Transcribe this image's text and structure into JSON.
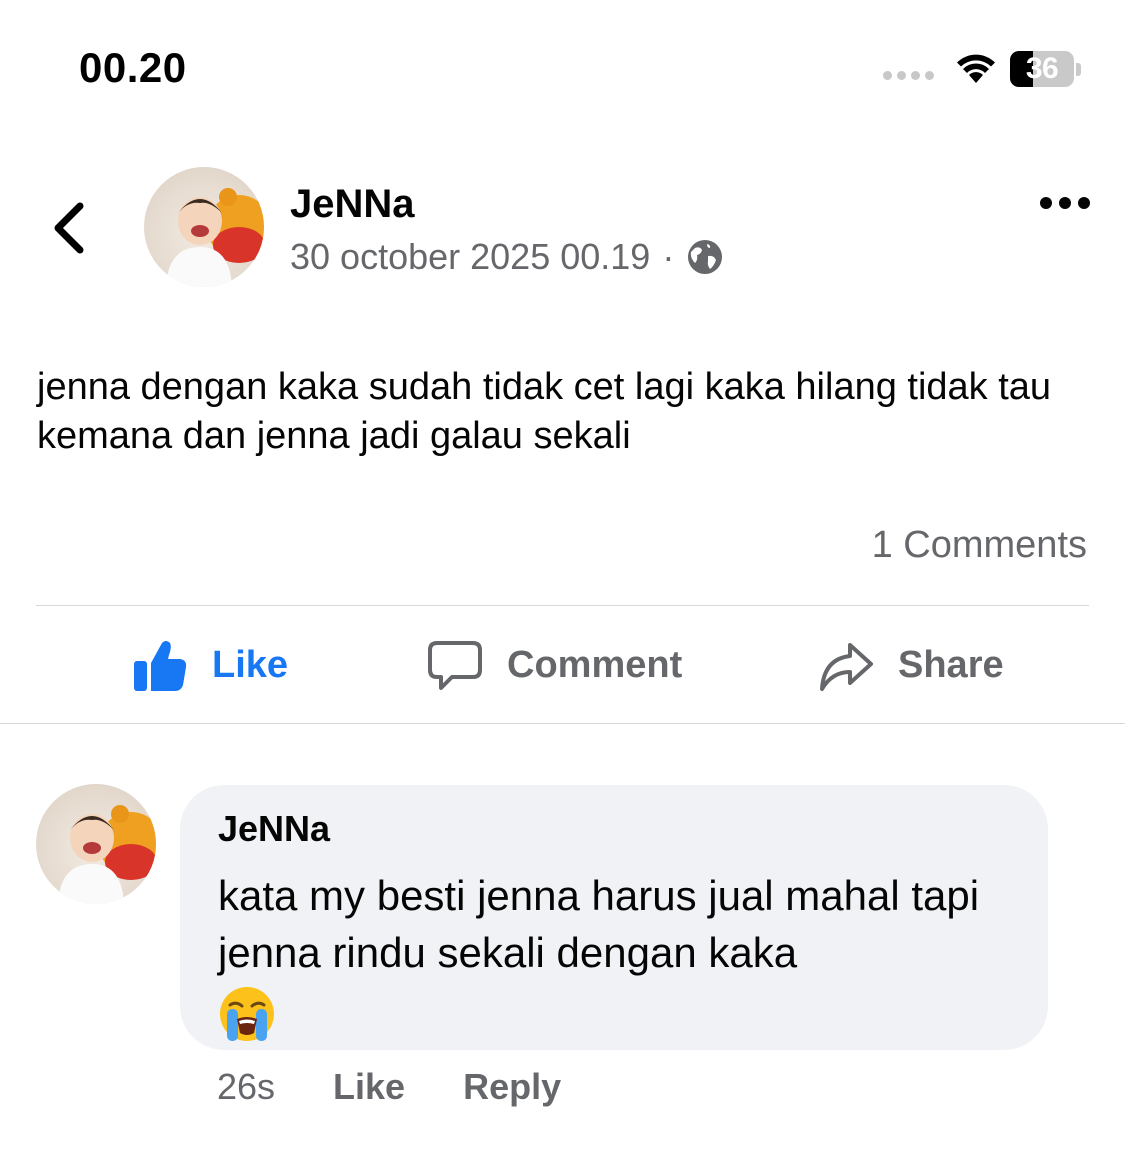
{
  "status_bar": {
    "time": "00.20",
    "battery_level": "36",
    "battery_fraction": 0.36
  },
  "post": {
    "author": "JeNNa",
    "timestamp": "30 october 2025 00.19",
    "meta_separator": "·",
    "audience_icon": "globe-icon",
    "text": "jenna dengan kaka sudah tidak cet lagi kaka hilang tidak tau kemana dan jenna jadi galau sekali",
    "comment_count": "1 Comments"
  },
  "actions": {
    "like": "Like",
    "comment": "Comment",
    "share": "Share",
    "like_color": "#1877f2"
  },
  "comment": {
    "author": "JeNNa",
    "text": "kata my besti jenna harus jual mahal tapi jenna rindu sekali dengan kaka",
    "emoji": "loudly-crying-face",
    "age": "26s",
    "like_label": "Like",
    "reply_label": "Reply"
  },
  "colors": {
    "secondary_text": "#65676b",
    "bubble_bg": "#f0f2f5",
    "divider": "#d6d8db"
  }
}
